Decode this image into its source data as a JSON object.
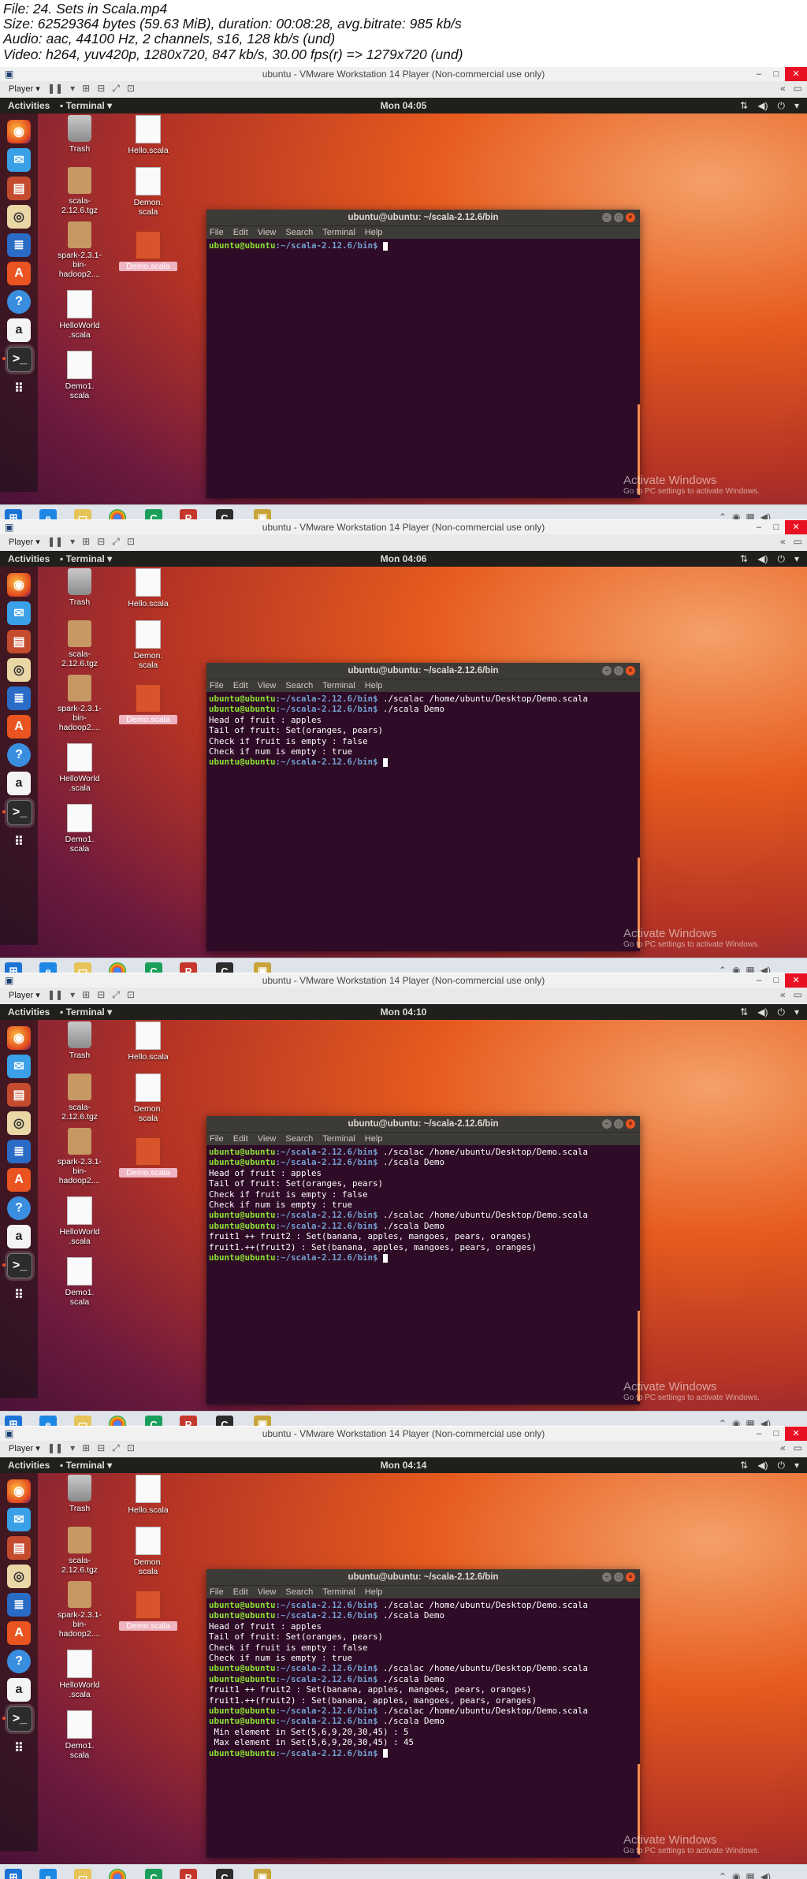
{
  "header": {
    "line1": "File: 24. Sets in Scala.mp4",
    "line2": "Size: 62529364 bytes (59.63 MiB), duration: 00:08:28, avg.bitrate: 985 kb/s",
    "line3": "Audio: aac, 44100 Hz, 2 channels, s16, 128 kb/s (und)",
    "line4": "Video: h264, yuv420p, 1280x720, 847 kb/s, 30.00 fps(r) => 1279x720 (und)"
  },
  "common": {
    "vm_title": "ubuntu - VMware Workstation 14 Player (Non-commercial use only)",
    "player_label": "Player",
    "activities": "Activities",
    "app_menu": "Terminal",
    "term_title": "ubuntu@ubuntu: ~/scala-2.12.6/bin",
    "term_menu": [
      "File",
      "Edit",
      "View",
      "Search",
      "Terminal",
      "Help"
    ],
    "prompt_user": "ubuntu@ubuntu",
    "prompt_path": ":~/scala-2.12.6/bin$",
    "activate_big": "Activate Windows",
    "activate_small": "Go to PC settings to activate Windows.",
    "desktop_icons": {
      "trash": "Trash",
      "hello": "Hello.scala",
      "scala_tgz": "scala-\n2.12.6.tgz",
      "demon": "Demon.\nscala",
      "spark": "spark-2.3.1-\nbin-\nhadoop2....",
      "demo_sel": "Demo.scala",
      "helloworld": "HelloWorld\n.scala",
      "demo1": "Demo1.\nscala"
    }
  },
  "frames": [
    {
      "clock": "Mon 04:05",
      "lines": [
        {
          "p": true,
          "cmd": " ",
          "cursor": true
        }
      ]
    },
    {
      "clock": "Mon 04:06",
      "lines": [
        {
          "p": true,
          "cmd": " ./scalac /home/ubuntu/Desktop/Demo.scala"
        },
        {
          "p": true,
          "cmd": " ./scala Demo"
        },
        {
          "p": false,
          "cmd": "Head of fruit : apples"
        },
        {
          "p": false,
          "cmd": "Tail of fruit: Set(oranges, pears)"
        },
        {
          "p": false,
          "cmd": "Check if fruit is empty : false"
        },
        {
          "p": false,
          "cmd": "Check if num is empty : true"
        },
        {
          "p": true,
          "cmd": " ",
          "cursor": true
        }
      ]
    },
    {
      "clock": "Mon 04:10",
      "lines": [
        {
          "p": true,
          "cmd": " ./scalac /home/ubuntu/Desktop/Demo.scala"
        },
        {
          "p": true,
          "cmd": " ./scala Demo"
        },
        {
          "p": false,
          "cmd": "Head of fruit : apples"
        },
        {
          "p": false,
          "cmd": "Tail of fruit: Set(oranges, pears)"
        },
        {
          "p": false,
          "cmd": "Check if fruit is empty : false"
        },
        {
          "p": false,
          "cmd": "Check if num is empty : true"
        },
        {
          "p": true,
          "cmd": " ./scalac /home/ubuntu/Desktop/Demo.scala"
        },
        {
          "p": true,
          "cmd": " ./scala Demo"
        },
        {
          "p": false,
          "cmd": "fruit1 ++ fruit2 : Set(banana, apples, mangoes, pears, oranges)"
        },
        {
          "p": false,
          "cmd": "fruit1.++(fruit2) : Set(banana, apples, mangoes, pears, oranges)"
        },
        {
          "p": true,
          "cmd": " ",
          "cursor": true
        }
      ]
    },
    {
      "clock": "Mon 04:14",
      "lines": [
        {
          "p": true,
          "cmd": " ./scalac /home/ubuntu/Desktop/Demo.scala"
        },
        {
          "p": true,
          "cmd": " ./scala Demo"
        },
        {
          "p": false,
          "cmd": "Head of fruit : apples"
        },
        {
          "p": false,
          "cmd": "Tail of fruit: Set(oranges, pears)"
        },
        {
          "p": false,
          "cmd": "Check if fruit is empty : false"
        },
        {
          "p": false,
          "cmd": "Check if num is empty : true"
        },
        {
          "p": true,
          "cmd": " ./scalac /home/ubuntu/Desktop/Demo.scala"
        },
        {
          "p": true,
          "cmd": " ./scala Demo"
        },
        {
          "p": false,
          "cmd": "fruit1 ++ fruit2 : Set(banana, apples, mangoes, pears, oranges)"
        },
        {
          "p": false,
          "cmd": "fruit1.++(fruit2) : Set(banana, apples, mangoes, pears, oranges)"
        },
        {
          "p": true,
          "cmd": " ./scalac /home/ubuntu/Desktop/Demo.scala"
        },
        {
          "p": true,
          "cmd": " ./scala Demo"
        },
        {
          "p": false,
          "cmd": " Min element in Set(5,6,9,20,30,45) : 5"
        },
        {
          "p": false,
          "cmd": " Max element in Set(5,6,9,20,30,45) : 45"
        },
        {
          "p": true,
          "cmd": " ",
          "cursor": true
        }
      ]
    }
  ],
  "colors": {
    "terminal_bg": "#2e0b26",
    "prompt_user": "#8ae234",
    "prompt_path": "#729fcf",
    "ubuntu_orange": "#e95420"
  }
}
